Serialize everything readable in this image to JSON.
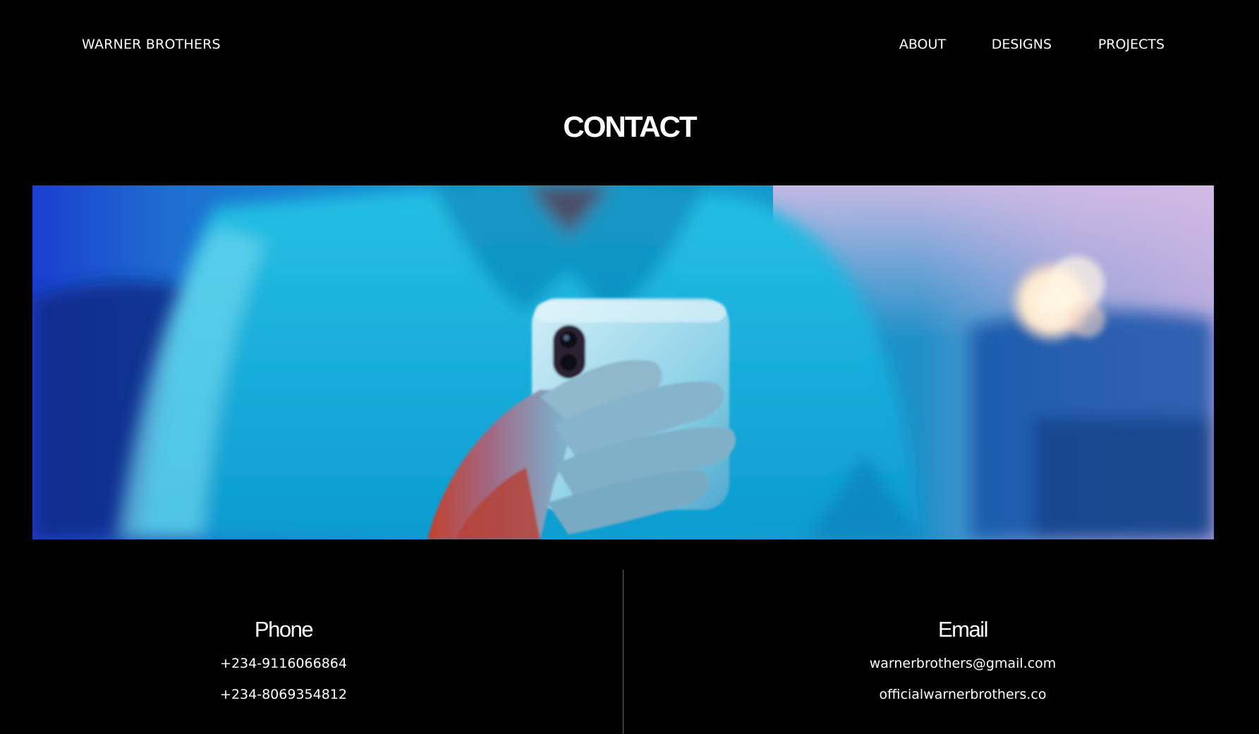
{
  "header": {
    "brand": "WARNER BROTHERS",
    "nav": [
      {
        "label": "ABOUT"
      },
      {
        "label": "DESIGNS"
      },
      {
        "label": "PROJECTS"
      }
    ]
  },
  "page": {
    "title": "CONTACT"
  },
  "hero": {
    "image": "person-holding-smartphone-photo",
    "palette": {
      "primary": "#0aa0d0",
      "shadow": "#063a78",
      "highlight": "#c8b4e0",
      "skin": "#b84a3a"
    }
  },
  "contact": {
    "phone": {
      "heading": "Phone",
      "numbers": [
        "+234-9116066864",
        "+234-8069354812"
      ]
    },
    "email": {
      "heading": "Email",
      "addresses": [
        "warnerbrothers@gmail.com",
        "officialwarnerbrothers.co"
      ]
    }
  }
}
